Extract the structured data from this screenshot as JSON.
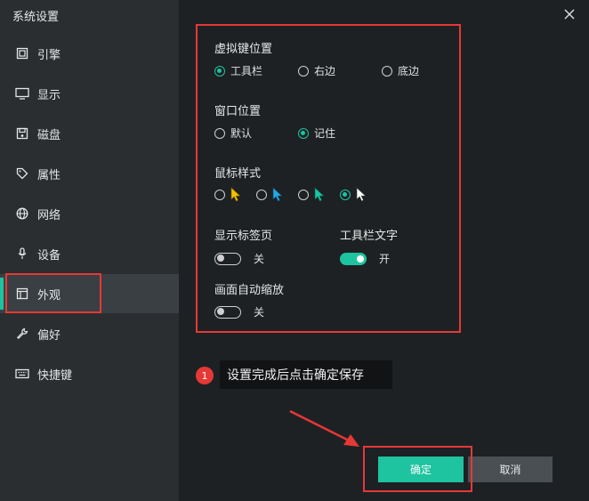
{
  "window": {
    "title": "系统设置"
  },
  "sidebar": {
    "items": [
      {
        "id": "engine",
        "label": "引擎",
        "icon": "chip-icon"
      },
      {
        "id": "display",
        "label": "显示",
        "icon": "monitor-icon"
      },
      {
        "id": "disk",
        "label": "磁盘",
        "icon": "disk-icon"
      },
      {
        "id": "property",
        "label": "属性",
        "icon": "tag-icon"
      },
      {
        "id": "network",
        "label": "网络",
        "icon": "globe-icon"
      },
      {
        "id": "device",
        "label": "设备",
        "icon": "microphone-icon"
      },
      {
        "id": "appearance",
        "label": "外观",
        "icon": "window-icon",
        "active": true
      },
      {
        "id": "preference",
        "label": "偏好",
        "icon": "wrench-icon"
      },
      {
        "id": "hotkey",
        "label": "快捷键",
        "icon": "keyboard-icon"
      }
    ]
  },
  "settings": {
    "virtual_key_position": {
      "label": "虚拟键位置",
      "options": [
        {
          "label": "工具栏",
          "checked": true
        },
        {
          "label": "右边",
          "checked": false
        },
        {
          "label": "底边",
          "checked": false
        }
      ]
    },
    "window_position": {
      "label": "窗口位置",
      "options": [
        {
          "label": "默认",
          "checked": false
        },
        {
          "label": "记住",
          "checked": true
        }
      ]
    },
    "mouse_style": {
      "label": "鼠标样式",
      "options": [
        {
          "cursor_color": "#f2c200",
          "checked": false
        },
        {
          "cursor_color": "#29a8e0",
          "checked": false
        },
        {
          "cursor_color": "#1ec3a0",
          "checked": false
        },
        {
          "cursor_color": "#ffffff",
          "checked": true
        }
      ]
    },
    "show_tabs": {
      "label": "显示标签页",
      "state_label": "关",
      "on": false
    },
    "toolbar_text": {
      "label": "工具栏文字",
      "state_label": "开",
      "on": true
    },
    "auto_scale": {
      "label": "画面自动缩放",
      "state_label": "关",
      "on": false
    }
  },
  "tip": {
    "badge": "1",
    "text": "设置完成后点击确定保存"
  },
  "buttons": {
    "confirm": "确定",
    "cancel": "取消"
  },
  "colors": {
    "accent": "#1ec3a0",
    "highlight": "#e53935"
  }
}
